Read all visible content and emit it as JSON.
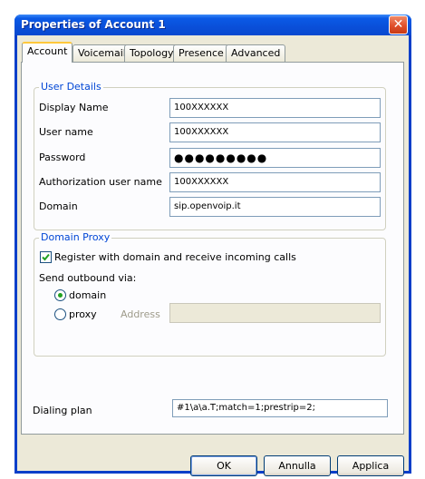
{
  "window": {
    "title": "Properties of Account 1",
    "close_glyph": "✕"
  },
  "tabs": [
    {
      "label": "Account",
      "active": true
    },
    {
      "label": "Voicemail",
      "active": false
    },
    {
      "label": "Topology",
      "active": false
    },
    {
      "label": "Presence",
      "active": false
    },
    {
      "label": "Advanced",
      "active": false
    }
  ],
  "user_details": {
    "legend": "User Details",
    "display_name": {
      "label": "Display Name",
      "value": "100XXXXXX"
    },
    "user_name": {
      "label": "User name",
      "value": "100XXXXXX"
    },
    "password": {
      "label": "Password",
      "value": "●●●●●●●●●"
    },
    "auth_user_name": {
      "label": "Authorization user name",
      "value": "100XXXXXX"
    },
    "domain": {
      "label": "Domain",
      "value": "sip.openvoip.it"
    }
  },
  "domain_proxy": {
    "legend": "Domain Proxy",
    "register_checkbox": {
      "label": "Register with domain and receive incoming calls",
      "checked": true
    },
    "send_outbound_label": "Send outbound via:",
    "radio_domain": {
      "label": "domain",
      "selected": true
    },
    "radio_proxy": {
      "label": "proxy",
      "selected": false
    },
    "address": {
      "label": "Address",
      "value": ""
    }
  },
  "dialing_plan": {
    "label": "Dialing plan",
    "value": "#1\\a\\a.T;match=1;prestrip=2;"
  },
  "buttons": {
    "ok": "OK",
    "cancel": "Annulla",
    "apply": "Applica"
  },
  "colors": {
    "titlebar": "#0a4fd9",
    "dialog_bg": "#ece9d8",
    "legend_text": "#0046d5",
    "active_tab_accent": "#ffc83c"
  }
}
